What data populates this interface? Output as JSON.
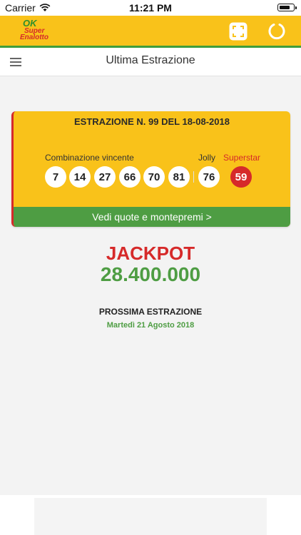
{
  "status_bar": {
    "carrier": "Carrier",
    "time": "11:21 PM",
    "icons": [
      "wifi-icon",
      "battery-icon"
    ]
  },
  "app_bar": {
    "logo": {
      "ok": "OK",
      "line1": "Super",
      "line2": "Enalotto"
    },
    "actions": [
      "fullscreen-icon",
      "refresh-icon"
    ]
  },
  "nav": {
    "title": "Ultima Estrazione",
    "menu_icon": "hamburger-menu-icon"
  },
  "draw": {
    "title": "ESTRAZIONE N. 99 DEL 18-08-2018",
    "winning_label": "Combinazione vincente",
    "numbers": [
      "7",
      "14",
      "27",
      "66",
      "70",
      "81"
    ],
    "jolly_label": "Jolly",
    "jolly": "76",
    "superstar_label": "Superstar",
    "superstar": "59",
    "footer_link": "Vedi quote e montepremi >"
  },
  "jackpot": {
    "label": "JACKPOT",
    "amount": "28.400.000"
  },
  "next_draw": {
    "label": "PROSSIMA ESTRAZIONE",
    "date": "Martedì 21 Agosto 2018"
  },
  "colors": {
    "yellow": "#f9c21a",
    "green": "#4e9d43",
    "red": "#d62a2a"
  }
}
